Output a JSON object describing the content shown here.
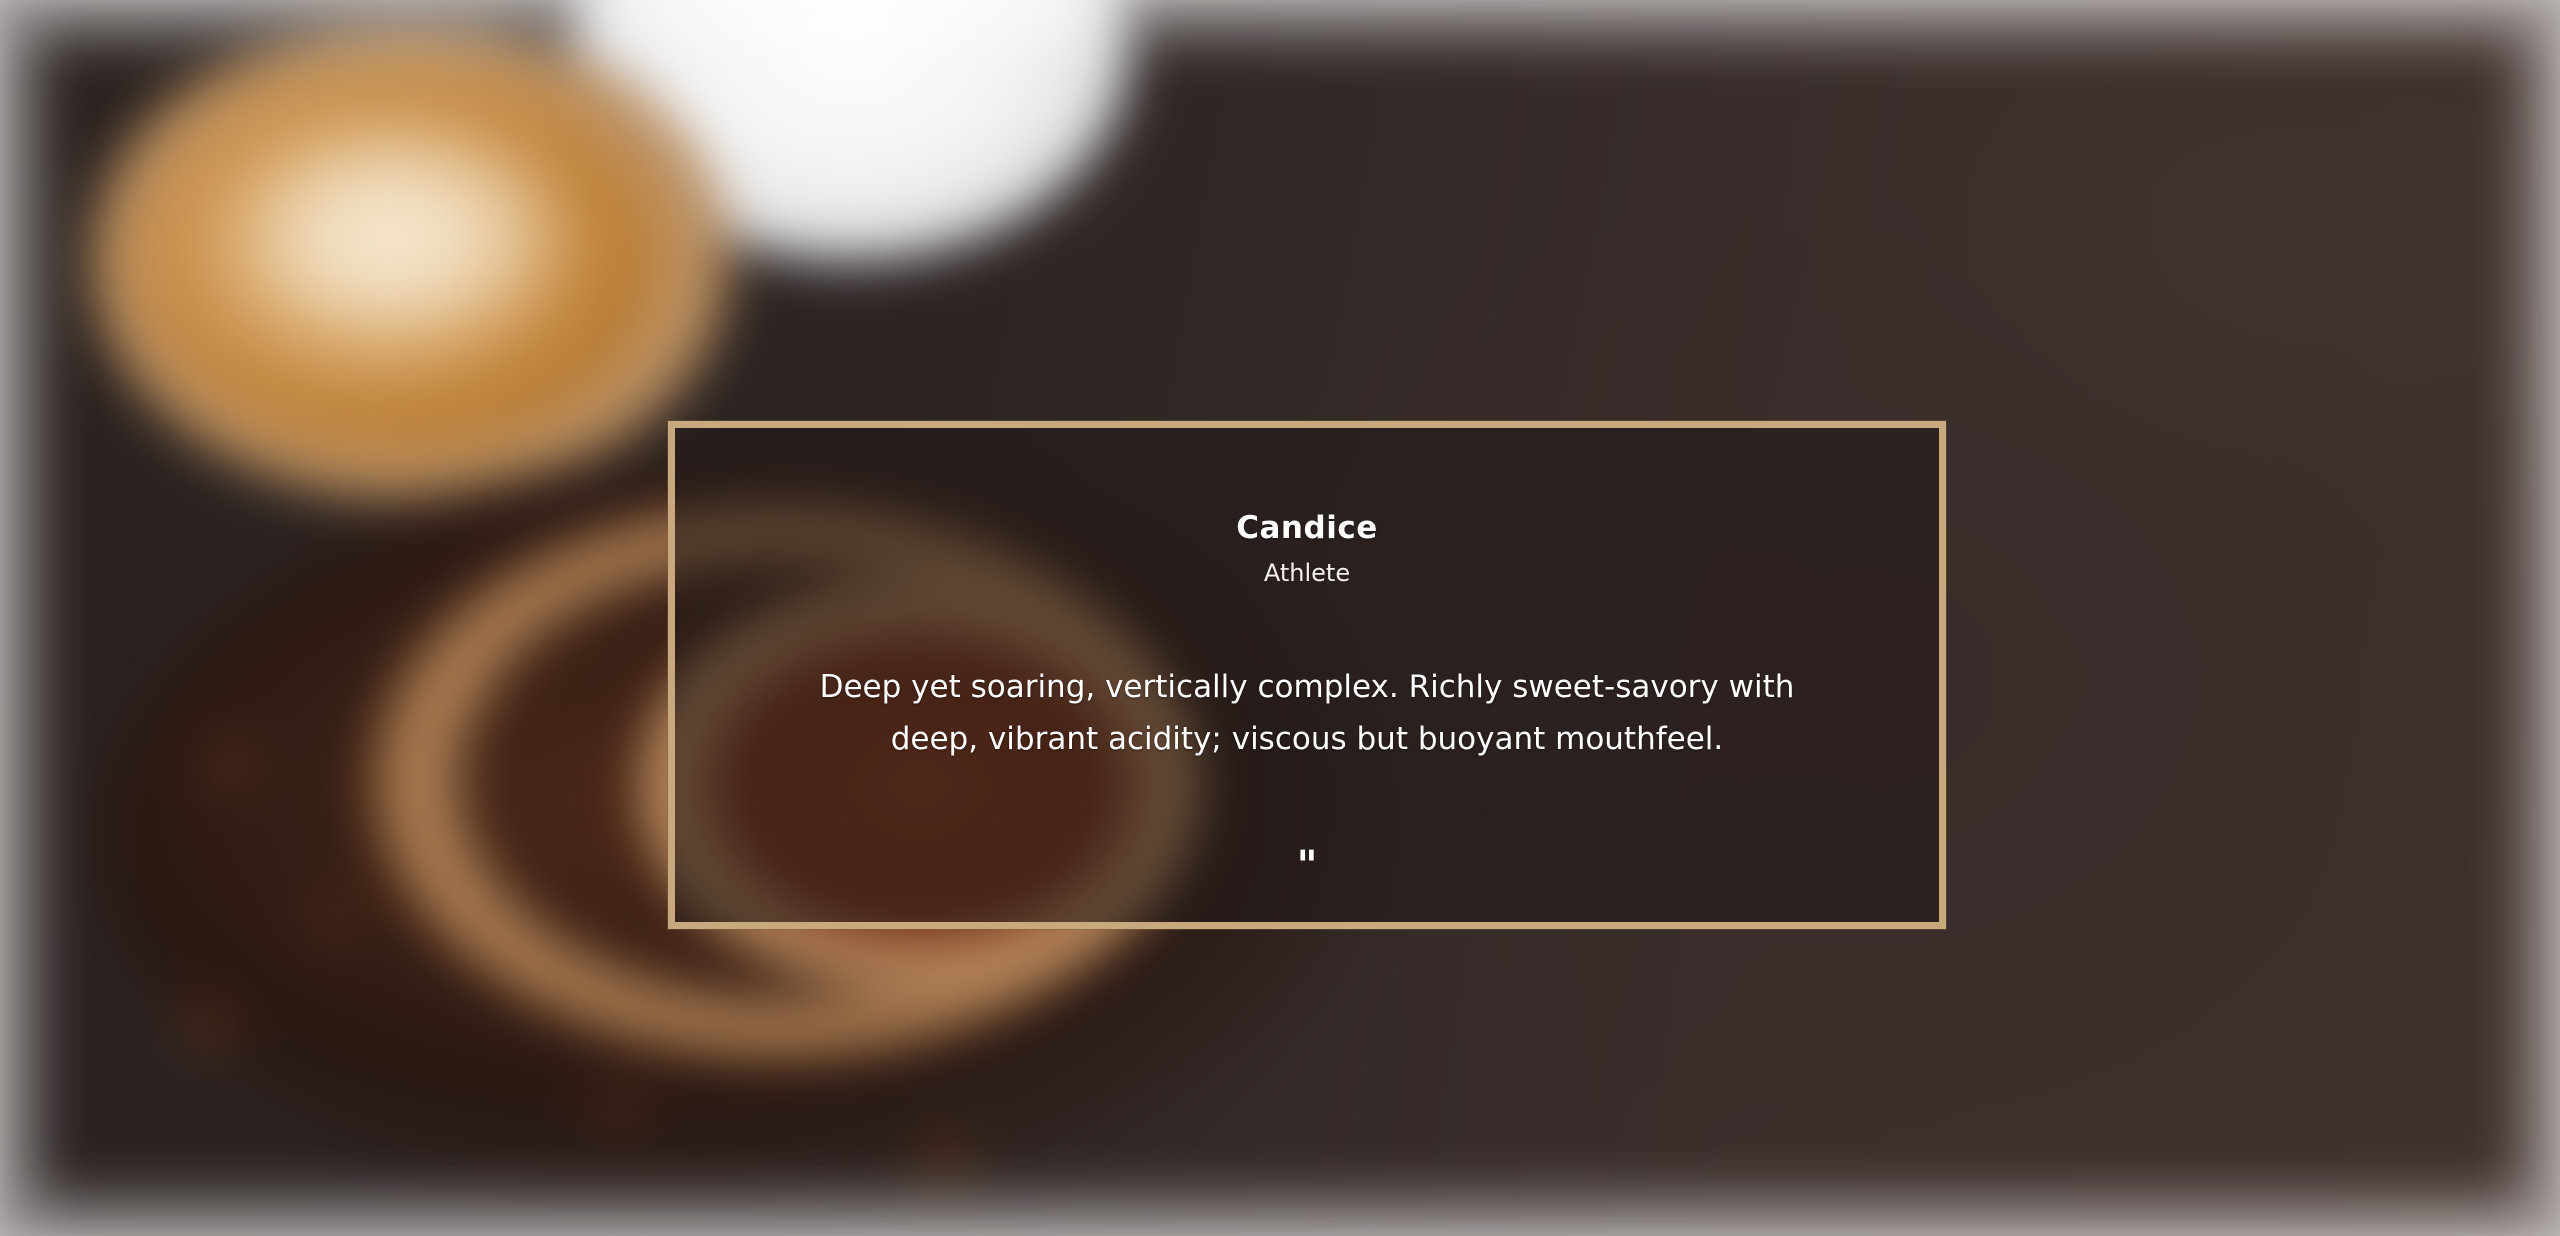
{
  "testimonial": {
    "name": "Candice",
    "role": "Athlete",
    "quote": "Deep yet soaring, vertically complex. Richly sweet-savory with deep, vibrant acidity; viscous but buoyant mouthfeel.",
    "quote_mark": "\""
  },
  "colors": {
    "border_accent": "#c7a97d",
    "text": "#ffffff",
    "background_dark": "#2c2423"
  }
}
